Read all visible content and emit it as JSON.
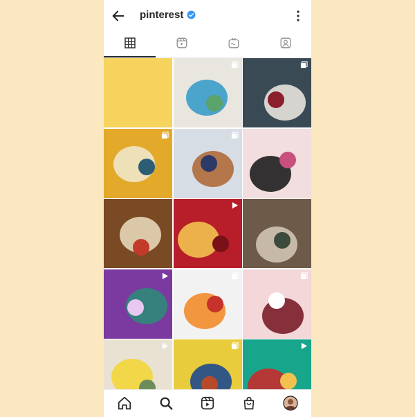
{
  "header": {
    "profile_name": "pinterest",
    "back_icon": "arrow-left-icon",
    "verified_icon": "verified-badge-icon",
    "more_icon": "more-vertical-icon"
  },
  "tabs": [
    {
      "id": "posts",
      "icon": "grid-icon",
      "active": true
    },
    {
      "id": "reels",
      "icon": "reels-icon",
      "active": false
    },
    {
      "id": "igtv",
      "icon": "igtv-icon",
      "active": false
    },
    {
      "id": "tagged",
      "icon": "tagged-icon",
      "active": false
    }
  ],
  "posts": [
    {
      "id": 1,
      "type": "image",
      "colors": [
        "#f6d35d"
      ]
    },
    {
      "id": 2,
      "type": "multiple",
      "colors": [
        "#e9e6df",
        "#3a9cc9",
        "#5aa36a"
      ]
    },
    {
      "id": 3,
      "type": "multiple",
      "colors": [
        "#3a4a55",
        "#e8e3dd",
        "#8b1f2b"
      ]
    },
    {
      "id": 4,
      "type": "multiple",
      "colors": [
        "#e2a92b",
        "#efe6c6",
        "#2b5d75"
      ]
    },
    {
      "id": 5,
      "type": "multiple",
      "colors": [
        "#d7dde5",
        "#b06a3a",
        "#2b3a66"
      ]
    },
    {
      "id": 6,
      "type": "image",
      "colors": [
        "#f2dede",
        "#1e1e1e",
        "#c94f7c"
      ]
    },
    {
      "id": 7,
      "type": "image",
      "colors": [
        "#7a4a25",
        "#e6d6b8",
        "#c23b2a"
      ]
    },
    {
      "id": 8,
      "type": "video",
      "colors": [
        "#b81e2a",
        "#f2c14e",
        "#7a1018"
      ]
    },
    {
      "id": 9,
      "type": "image",
      "colors": [
        "#6e5a49",
        "#cfc3b2",
        "#3d4a3e"
      ]
    },
    {
      "id": 10,
      "type": "video",
      "colors": [
        "#7a3aa0",
        "#2f8a7a",
        "#e8c7f0"
      ]
    },
    {
      "id": 11,
      "type": "multiple",
      "colors": [
        "#f2f2f2",
        "#f28c2b",
        "#c7322b"
      ]
    },
    {
      "id": 12,
      "type": "multiple",
      "colors": [
        "#f4d7d9",
        "#7a1e2a",
        "#ffffff"
      ]
    },
    {
      "id": 13,
      "type": "video",
      "colors": [
        "#e9e2d3",
        "#f3d63a",
        "#6d8c5c"
      ]
    },
    {
      "id": 14,
      "type": "multiple",
      "colors": [
        "#e8cc3c",
        "#1e4a8c",
        "#b84a2a"
      ]
    },
    {
      "id": 15,
      "type": "video",
      "colors": [
        "#17a68b",
        "#c42c2c",
        "#f2c14e"
      ]
    }
  ],
  "bottom_nav": [
    {
      "id": "home",
      "icon": "home-icon"
    },
    {
      "id": "search",
      "icon": "search-icon"
    },
    {
      "id": "reels",
      "icon": "reels-icon"
    },
    {
      "id": "shop",
      "icon": "shop-icon"
    },
    {
      "id": "profile",
      "icon": "avatar-icon"
    }
  ]
}
